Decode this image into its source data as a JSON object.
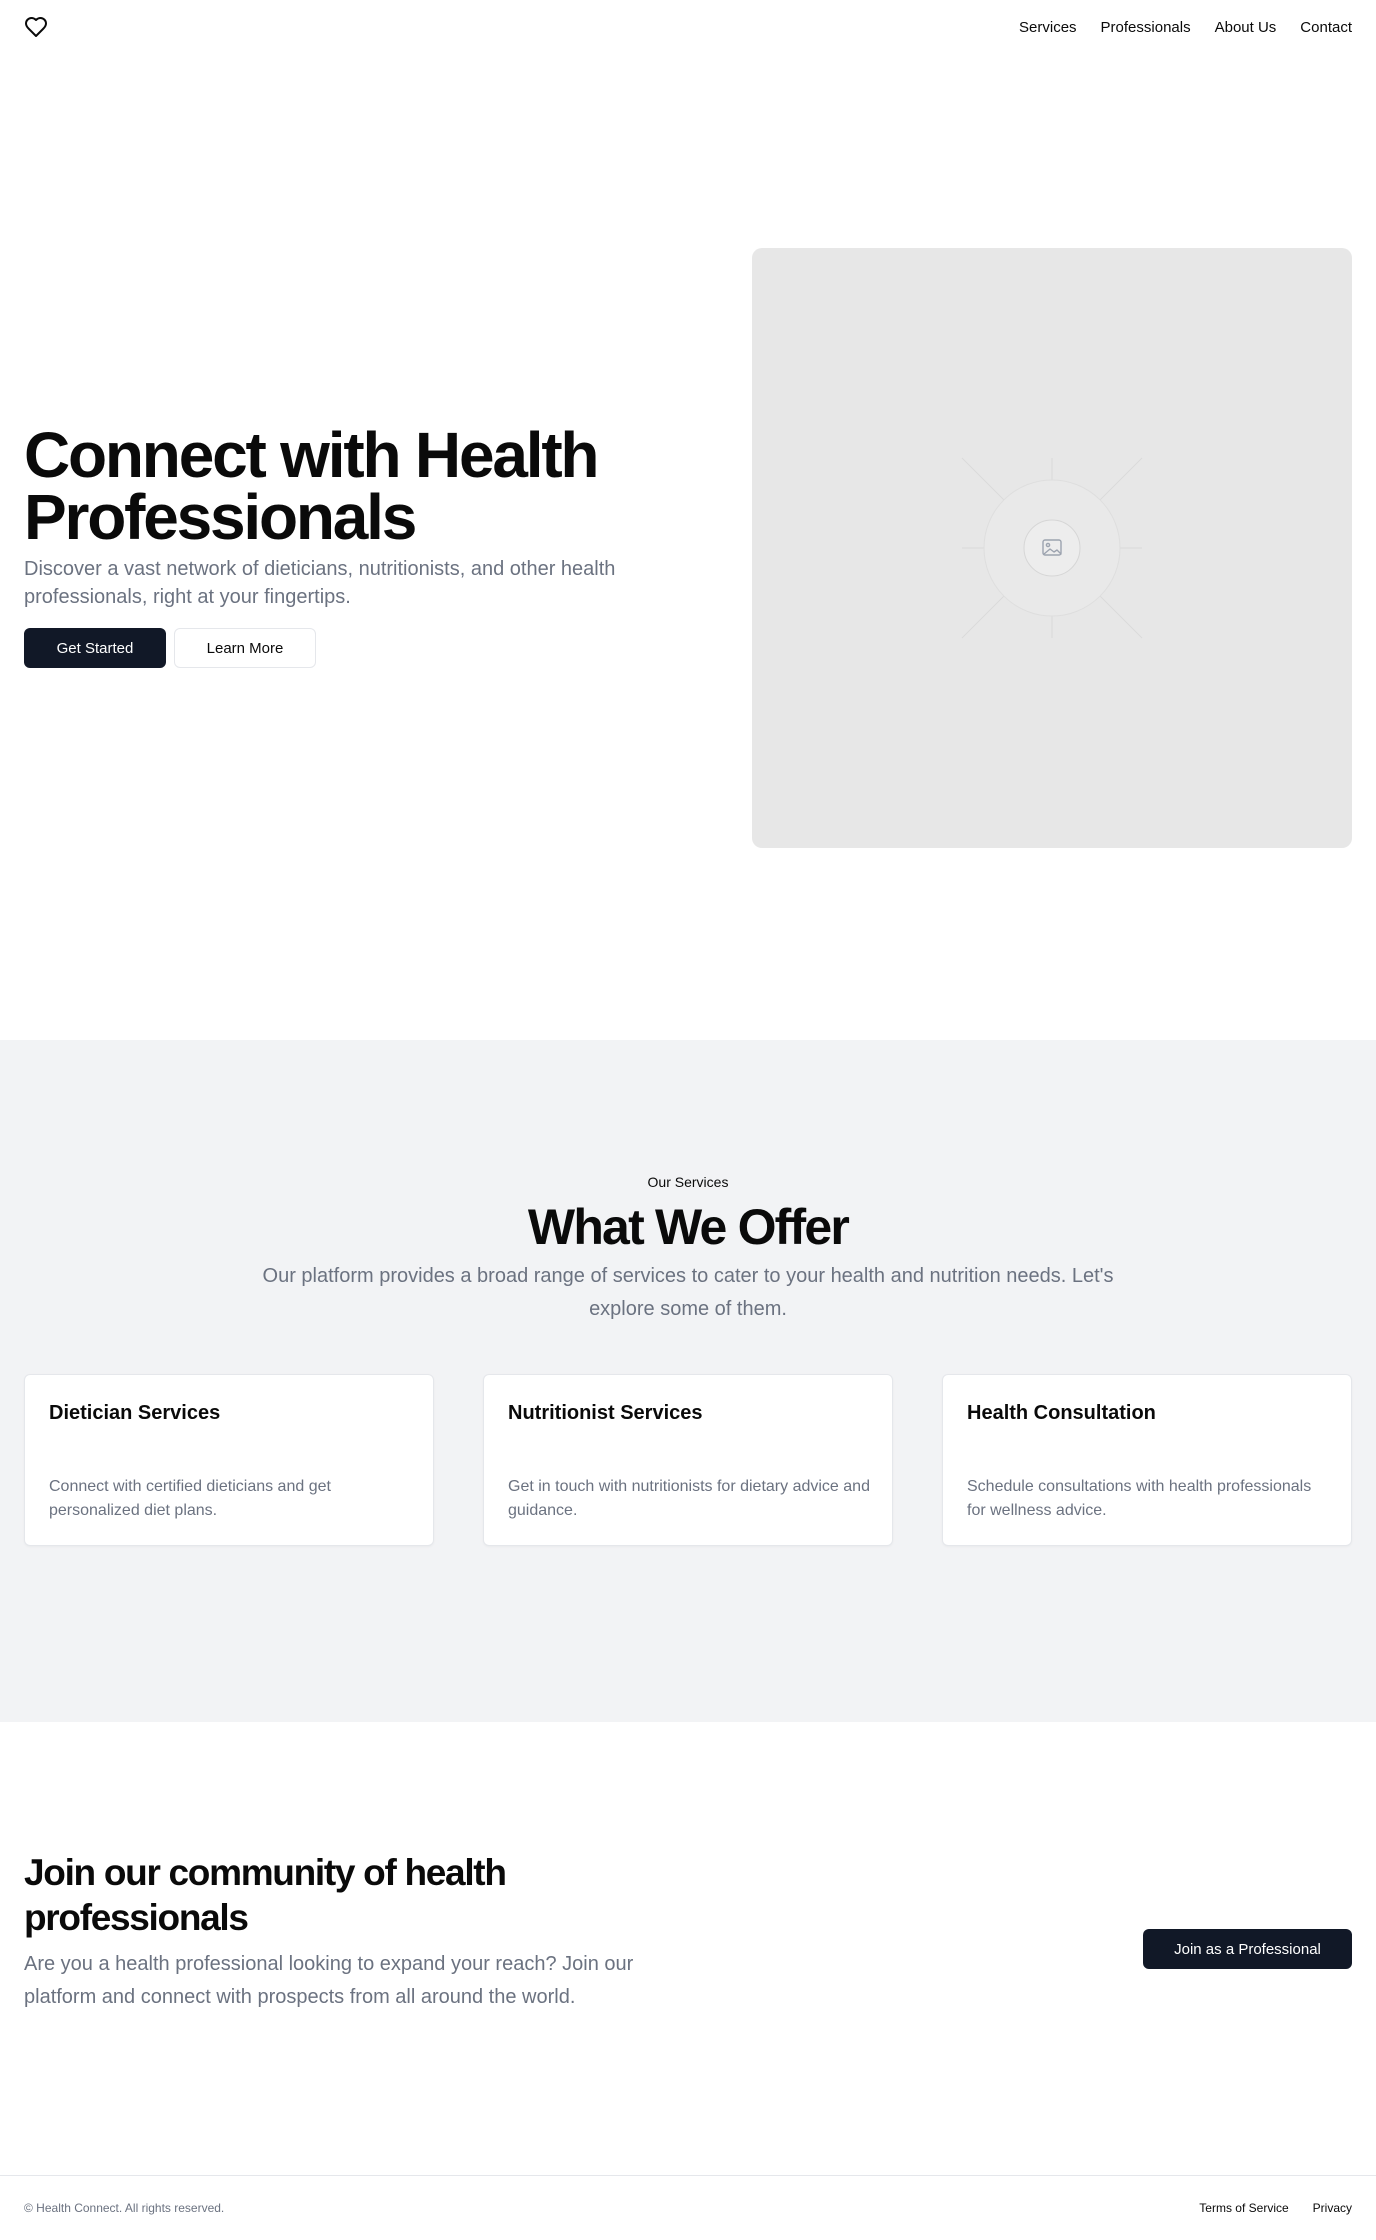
{
  "nav": {
    "logo_icon": "heart-icon",
    "items": [
      "Services",
      "Professionals",
      "About Us",
      "Contact"
    ]
  },
  "hero": {
    "title": "Connect with Health Professionals",
    "description": "Discover a vast network of dieticians, nutritionists, and other health professionals, right at your fingertips.",
    "primary_button": "Get Started",
    "secondary_button": "Learn More",
    "image_icon": "image-placeholder-icon"
  },
  "services": {
    "eyebrow": "Our Services",
    "title": "What We Offer",
    "description": "Our platform provides a broad range of services to cater to your health and nutrition needs. Let's explore some of them.",
    "cards": [
      {
        "title": "Dietician Services",
        "description": "Connect with certified dieticians and get personalized diet plans."
      },
      {
        "title": "Nutritionist Services",
        "description": "Get in touch with nutritionists for dietary advice and guidance."
      },
      {
        "title": "Health Consultation",
        "description": "Schedule consultations with health professionals for wellness advice."
      }
    ]
  },
  "join": {
    "title": "Join our community of health professionals",
    "description": "Are you a health professional looking to expand your reach? Join our platform and connect with prospects from all around the world.",
    "button": "Join as a Professional"
  },
  "footer": {
    "copyright": "© Health Connect. All rights reserved.",
    "links": [
      "Terms of Service",
      "Privacy"
    ]
  },
  "colors": {
    "primary_dark": "#111827",
    "muted_text": "#6b7280",
    "section_bg": "#f2f3f5",
    "placeholder_bg": "#e7e7e7"
  }
}
